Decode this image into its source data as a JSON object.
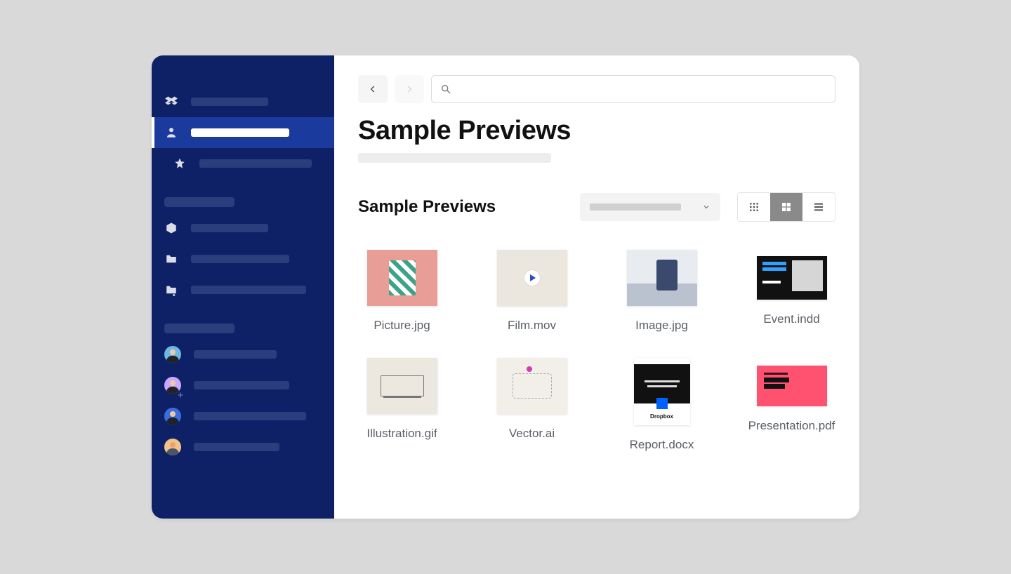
{
  "page": {
    "title": "Sample Previews",
    "folder_title": "Sample Previews"
  },
  "search": {
    "placeholder": ""
  },
  "view_mode": "large-grid",
  "files": [
    {
      "name": "Picture.jpg"
    },
    {
      "name": "Film.mov"
    },
    {
      "name": "Image.jpg"
    },
    {
      "name": "Event.indd"
    },
    {
      "name": "Illustration.gif"
    },
    {
      "name": "Vector.ai"
    },
    {
      "name": "Report.docx"
    },
    {
      "name": "Presentation.pdf"
    }
  ],
  "report_brand": "Dropbox"
}
